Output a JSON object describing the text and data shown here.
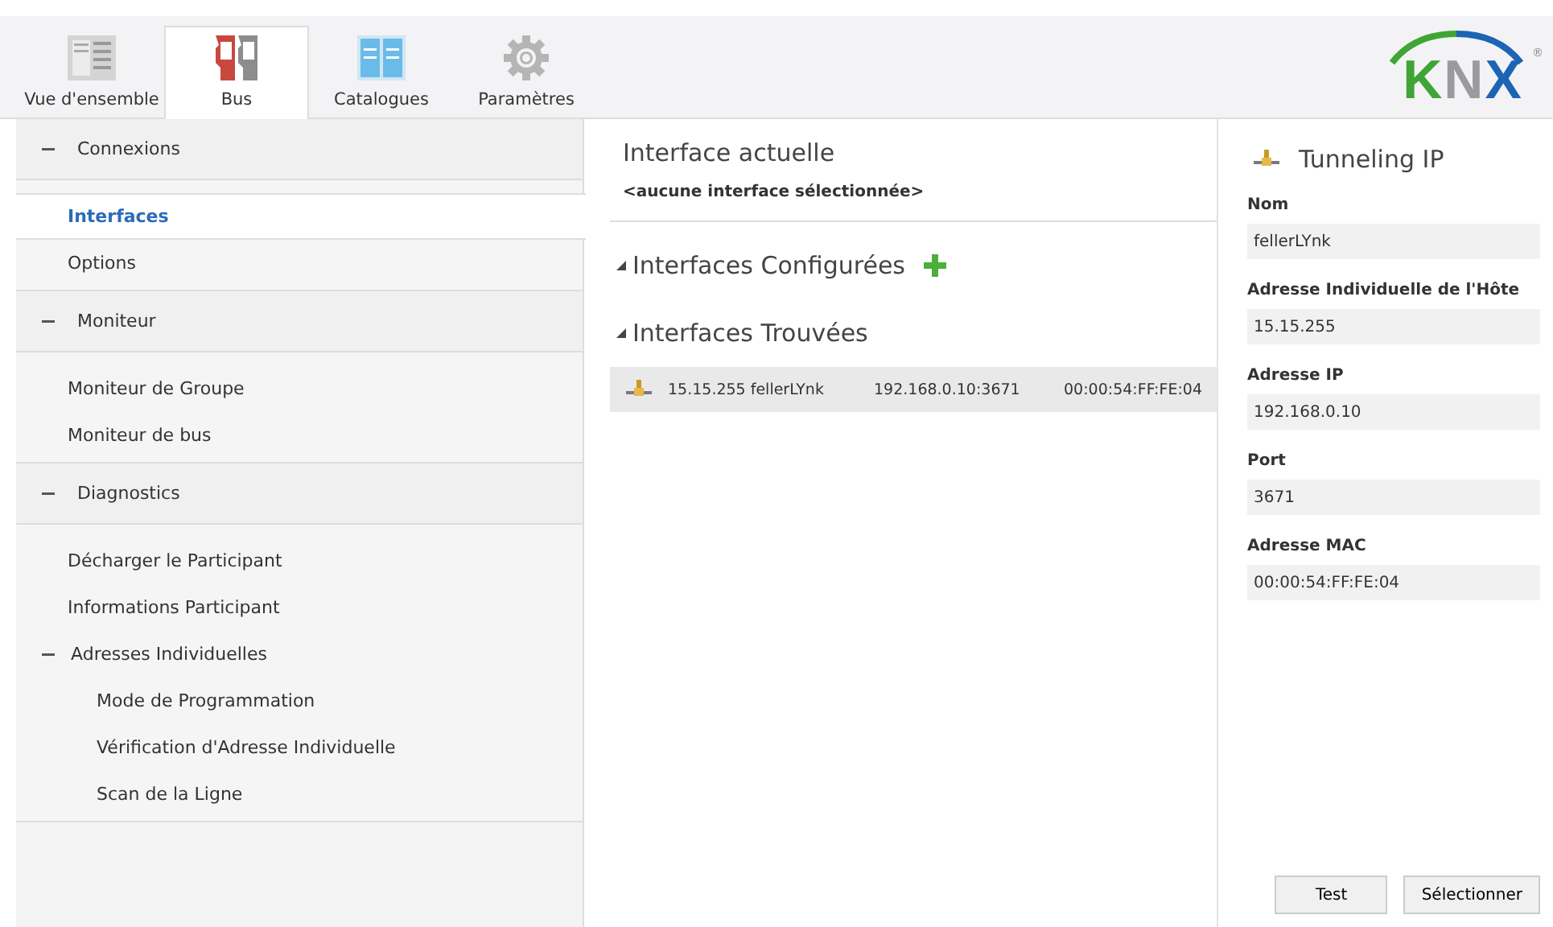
{
  "tabs": [
    {
      "label": "Vue d'ensemble",
      "kind": "overview",
      "selected": false
    },
    {
      "label": "Bus",
      "kind": "bus",
      "selected": true
    },
    {
      "label": "Catalogues",
      "kind": "catalog",
      "selected": false
    },
    {
      "label": "Paramètres",
      "kind": "settings",
      "selected": false
    }
  ],
  "logo": {
    "letters": [
      {
        "text": "K",
        "color": "#3fa535"
      },
      {
        "text": "N",
        "color": "#9a9b9d"
      },
      {
        "text": "X",
        "color": "#1c64b4"
      }
    ],
    "mark": "®"
  },
  "sidebar": {
    "groups": [
      {
        "label": "Connexions",
        "expanded": true,
        "children": [
          {
            "label": "Interfaces",
            "selected": true
          },
          {
            "label": "Options",
            "selected": false
          }
        ]
      },
      {
        "label": "Moniteur",
        "expanded": true,
        "children": [
          {
            "label": "Moniteur de Groupe",
            "selected": false
          },
          {
            "label": "Moniteur de bus",
            "selected": false
          }
        ]
      },
      {
        "label": "Diagnostics",
        "expanded": true,
        "children": [
          {
            "label": "Décharger le Participant",
            "selected": false
          },
          {
            "label": "Informations Participant",
            "selected": false
          },
          {
            "label": "Adresses Individuelles",
            "selected": false,
            "expanded": true,
            "children": [
              {
                "label": "Mode de Programmation",
                "selected": false
              },
              {
                "label": "Vérification d'Adresse Individuelle",
                "selected": false
              },
              {
                "label": "Scan de la Ligne",
                "selected": false
              }
            ]
          }
        ]
      }
    ]
  },
  "current": {
    "title": "Interface actuelle",
    "value": "<aucune interface sélectionnée>"
  },
  "sections": [
    {
      "title": "Interfaces Configurées",
      "expanded": true,
      "add": true
    },
    {
      "title": "Interfaces Trouvées",
      "expanded": true,
      "add": false,
      "rows": [
        {
          "address_name": "15.15.255 fellerLYnk",
          "ip": "192.168.0.10:3671",
          "mac": "00:00:54:FF:FE:04",
          "selected": true
        }
      ]
    }
  ],
  "details": {
    "title": "Tunneling IP",
    "fields": [
      {
        "label": "Nom",
        "value": "fellerLYnk"
      },
      {
        "label": "Adresse Individuelle de l'Hôte",
        "value": "15.15.255"
      },
      {
        "label": "Adresse IP",
        "value": "192.168.0.10"
      },
      {
        "label": "Port",
        "value": "3671"
      },
      {
        "label": "Adresse MAC",
        "value": "00:00:54:FF:FE:04"
      }
    ]
  },
  "buttons": [
    "Test",
    "Sélectionner"
  ]
}
